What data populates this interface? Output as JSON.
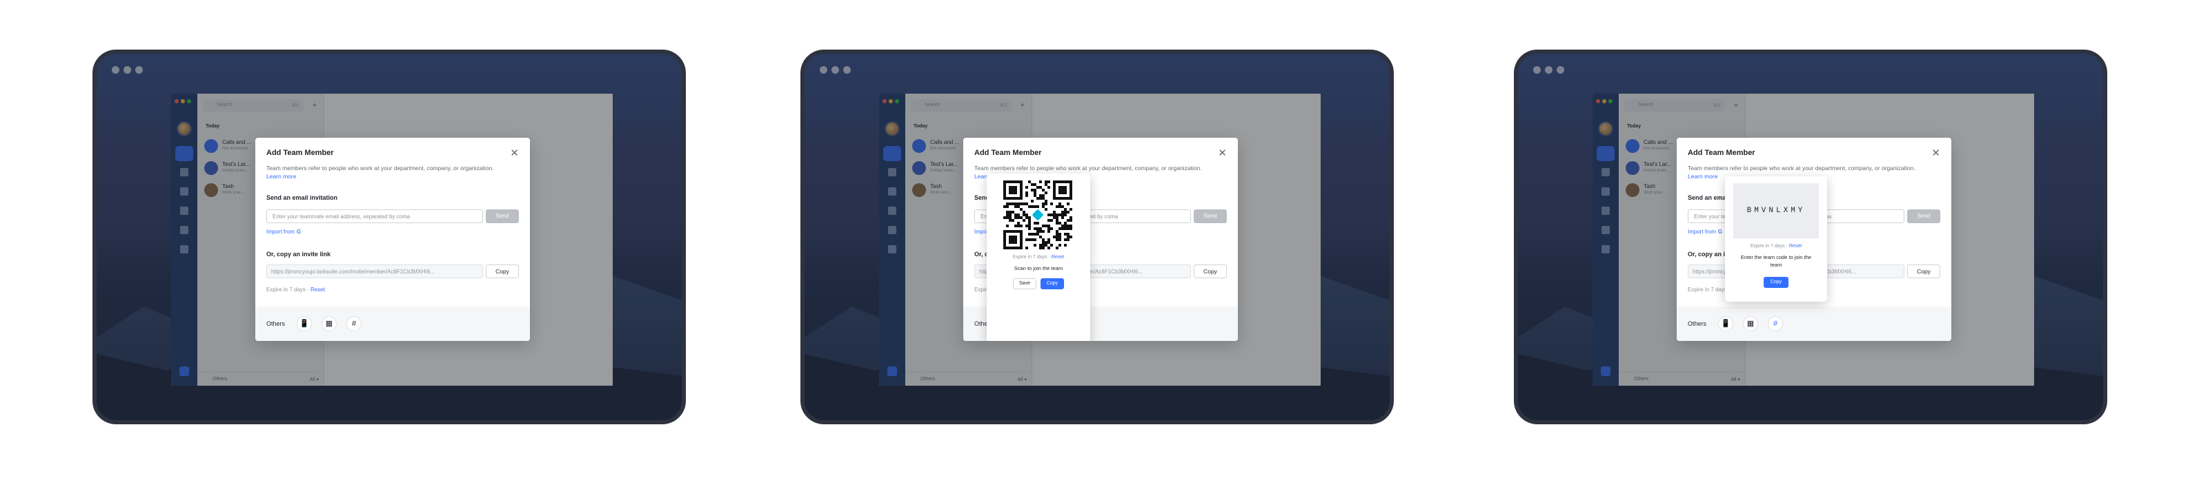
{
  "app": {
    "search_placeholder": "Search",
    "search_shortcut": "⌘K",
    "plus": "+",
    "today_label": "Today",
    "chats": [
      {
        "name": "Calls and ...",
        "preview": "Not answered"
      },
      {
        "name": "Test's Lar...",
        "preview": "Invited team..."
      },
      {
        "name": "Tash",
        "preview": "Work your..."
      }
    ],
    "others_label": "Others",
    "others_count": "All ▾"
  },
  "dialog": {
    "title": "Add Team Member",
    "close": "✕",
    "description": "Team members refer to people who work at your department, company, or organization.",
    "learn_more": "Learn more",
    "email_heading": "Send an email invitation",
    "email_placeholder": "Enter your teammate email address, separated by coma",
    "send": "Send",
    "import_from": "Import from",
    "google": "G",
    "link_heading": "Or, copy an invite link",
    "invite_link": "https://jimmcyoujo.larksuite.com/invite/member/Ac8F1Cb3MXHI6...",
    "copy": "Copy",
    "expire": "Expire in 7 days",
    "reset": "Reset",
    "others": "Others",
    "icons": {
      "phone": "📱",
      "qr": "▦",
      "hash": "#"
    }
  },
  "qr_popup": {
    "expire": "Expire in 7 days",
    "reset": "Reset",
    "scan_text": "Scan to join the team",
    "save": "Save",
    "copy": "Copy"
  },
  "code_popup": {
    "code": "BMVNLXMY",
    "expire": "Expire in 7 days",
    "reset": "Reset",
    "text": "Enter the team code to join the team",
    "copy": "Copy"
  }
}
